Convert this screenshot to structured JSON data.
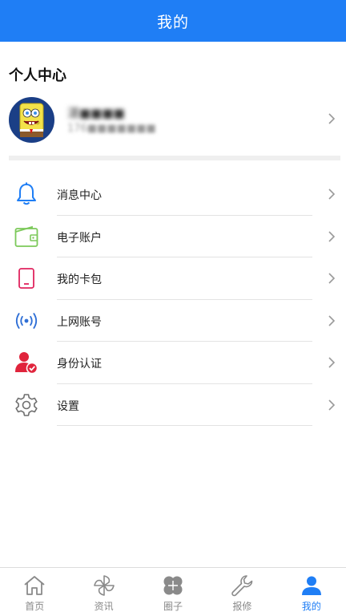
{
  "header": {
    "title": "我的"
  },
  "section": {
    "title": "个人中心"
  },
  "profile": {
    "name": "湛■■■■",
    "phone": "176■■■■■■■"
  },
  "menu": {
    "items": [
      {
        "label": "消息中心",
        "icon": "bell-icon"
      },
      {
        "label": "电子账户",
        "icon": "wallet-icon"
      },
      {
        "label": "我的卡包",
        "icon": "card-holder-icon"
      },
      {
        "label": "上网账号",
        "icon": "wireless-signal-icon"
      },
      {
        "label": "身份认证",
        "icon": "identity-verify-icon"
      },
      {
        "label": "设置",
        "icon": "gear-icon"
      }
    ]
  },
  "tabbar": {
    "active": "我的",
    "tabs": [
      {
        "label": "首页",
        "icon": "home-icon"
      },
      {
        "label": "资讯",
        "icon": "pinwheel-icon"
      },
      {
        "label": "圈子",
        "icon": "clover-icon"
      },
      {
        "label": "报修",
        "icon": "wrench-icon"
      },
      {
        "label": "我的",
        "icon": "user-icon"
      }
    ]
  },
  "colors": {
    "primary": "#1f7ef5",
    "wallet": "#7cc95a",
    "card_holder": "#e0245e",
    "identity": "#e0243c",
    "icon_gray": "#8a8a8a"
  }
}
